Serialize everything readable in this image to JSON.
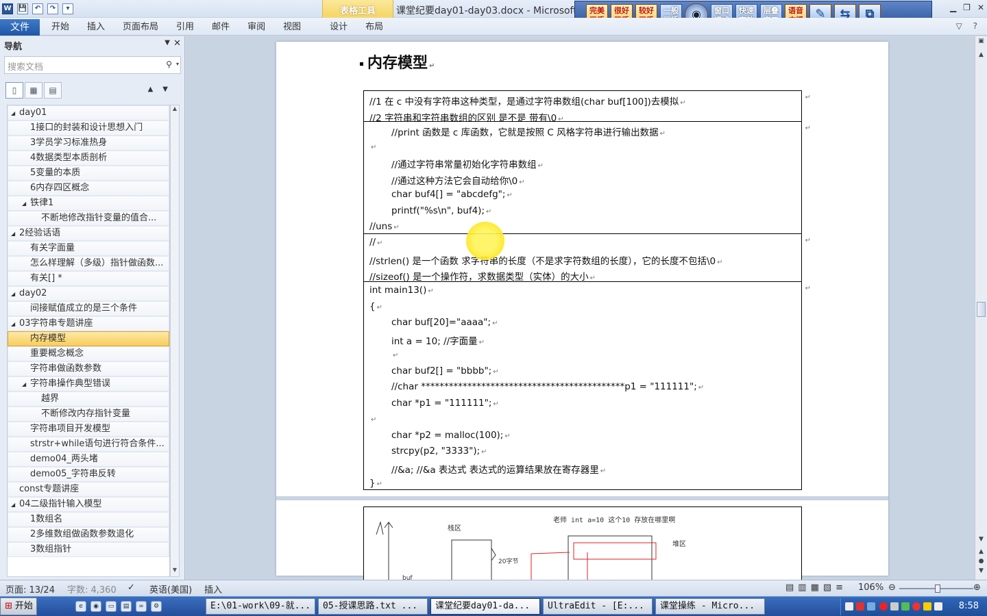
{
  "window": {
    "title": "课堂纪要day01-day03.docx - Microsoft W",
    "context_group": "表格工具",
    "controls": [
      "▁",
      "❐",
      "✕"
    ]
  },
  "quick_access": [
    "W",
    "💾",
    "↶",
    "↷",
    "▾"
  ],
  "toolband": {
    "buttons": [
      "完美画质",
      "很好画质",
      "较好画质",
      "一般画质",
      "◉",
      "窗口模式",
      "快速高效",
      "层叠窗口",
      "语音广播",
      "✎",
      "⇆",
      "⧉"
    ]
  },
  "ribbon": {
    "file_tab": "文件",
    "tabs": [
      "开始",
      "插入",
      "页面布局",
      "引用",
      "邮件",
      "审阅",
      "视图",
      "设计",
      "布局"
    ],
    "right": "▽ ?"
  },
  "nav": {
    "title": "导航",
    "close": "✕",
    "dropdown": "▼",
    "search_placeholder": "搜索文档",
    "search_icon": "⚲",
    "search_caret": "▾",
    "view_tabs": [
      "▯",
      "▦",
      "▤"
    ],
    "arrows": "▲▼",
    "items": [
      {
        "label": "day01",
        "level": 0,
        "expanded": true
      },
      {
        "label": "1接口的封装和设计思想入门",
        "level": 1
      },
      {
        "label": "3学员学习标准热身",
        "level": 1
      },
      {
        "label": "4数据类型本质剖析",
        "level": 1
      },
      {
        "label": "5变量的本质",
        "level": 1
      },
      {
        "label": "6内存四区概念",
        "level": 1
      },
      {
        "label": "铁律1",
        "level": 1,
        "expanded": true
      },
      {
        "label": "不断地修改指针变量的值合...",
        "level": 2
      },
      {
        "label": "2经验话语",
        "level": 0,
        "expanded": true
      },
      {
        "label": "有关字面量",
        "level": 1
      },
      {
        "label": "怎么样理解（多级）指针做函数...",
        "level": 1
      },
      {
        "label": "有关[] *",
        "level": 1
      },
      {
        "label": "day02",
        "level": 0,
        "expanded": true
      },
      {
        "label": "间接赋值成立的是三个条件",
        "level": 1
      },
      {
        "label": "03字符串专题讲座",
        "level": 0,
        "expanded": true
      },
      {
        "label": "内存模型",
        "level": 1,
        "selected": true
      },
      {
        "label": "重要概念概念",
        "level": 1
      },
      {
        "label": "字符串做函数参数",
        "level": 1
      },
      {
        "label": "字符串操作典型错误",
        "level": 1,
        "expanded": true
      },
      {
        "label": "越界",
        "level": 2
      },
      {
        "label": "不断修改内存指针变量",
        "level": 2
      },
      {
        "label": "字符串项目开发模型",
        "level": 1
      },
      {
        "label": "strstr+while语句进行符合条件...",
        "level": 1
      },
      {
        "label": "demo04_两头堵",
        "level": 1
      },
      {
        "label": "demo05_字符串反转",
        "level": 1
      },
      {
        "label": "const专题讲座",
        "level": 0
      },
      {
        "label": "04二级指针输入模型",
        "level": 0,
        "expanded": true
      },
      {
        "label": "1数组名",
        "level": 1
      },
      {
        "label": "2多维数组做函数参数退化",
        "level": 1
      },
      {
        "label": "3数组指针",
        "level": 1
      }
    ]
  },
  "doc": {
    "heading": "内存模型",
    "para_mark": "↵",
    "rows": [
      {
        "lines": [
          {
            "t": "//1 在 c 中没有字符串这种类型，是通过字符串数组(char buf[100])去模拟",
            "i": 0
          },
          {
            "t": "//2  字符串和字符串数组的区别 是不是 带有\\0",
            "i": 0
          }
        ]
      },
      {
        "lines": [
          {
            "t": "//print 函数是 c 库函数，它就是按照 C 风格字符串进行输出数据",
            "i": 1
          },
          {
            "t": "",
            "i": 0
          },
          {
            "t": "//通过字符串常量初始化字符串数组",
            "i": 1
          },
          {
            "t": "//通过这种方法它会自动给你\\0",
            "i": 1
          },
          {
            "t": "char buf4[] = \"abcdefg\";",
            "i": 1
          },
          {
            "t": "printf(\"%s\\n\", buf4);",
            "i": 1
          },
          {
            "t": "//uns",
            "i": 0
          }
        ]
      },
      {
        "lines": [
          {
            "t": "//",
            "i": 0
          },
          {
            "t": "//strlen()  是一个函数 求字符串的长度（不是求字符数组的长度），它的长度不包括\\0",
            "i": 0
          },
          {
            "t": "//sizeof()  是一个操作符，求数据类型（实体）的大小",
            "i": 0
          }
        ]
      },
      {
        "lines": [
          {
            "t": "int main13()",
            "i": 0
          },
          {
            "t": "{",
            "i": 0
          },
          {
            "t": "char buf[20]=\"aaaa\";",
            "i": 1
          },
          {
            "t": "int a = 10; //字面量",
            "i": 1
          },
          {
            "t": "",
            "i": 1
          },
          {
            "t": "char buf2[] = \"bbbb\";",
            "i": 1
          },
          {
            "t": "//char ********************************************p1 = \"111111\";",
            "i": 1
          },
          {
            "t": "char *p1 = \"111111\";",
            "i": 1
          },
          {
            "t": "",
            "i": 0
          },
          {
            "t": "char *p2 = malloc(100);",
            "i": 1
          },
          {
            "t": "strcpy(p2, \"3333\");",
            "i": 1
          },
          {
            "t": "//&a; //&a 表达式  表达式的运算结果放在寄存器里",
            "i": 1
          },
          {
            "t": "}",
            "i": 0
          }
        ]
      }
    ],
    "sketch": {
      "caption": "老师  int  a=10  这个10 存放在哪里啊",
      "stack": "栈区",
      "heap": "堆区",
      "bytes": "20字节",
      "buf": "buf"
    }
  },
  "status": {
    "page": "页面: 13/24",
    "words": "字数: 4,360",
    "lang": "英语(美国)",
    "mode": "插入",
    "zoom": "106%",
    "minus": "⊖",
    "plus": "⊕"
  },
  "taskbar": {
    "start": "开始",
    "items": [
      "E:\\01-work\\09-就...",
      "05-授课思路.txt ...",
      "课堂纪要day01-da...",
      "UltraEdit - [E:...",
      "课堂操练 - Micro..."
    ],
    "clock": "8:58"
  }
}
